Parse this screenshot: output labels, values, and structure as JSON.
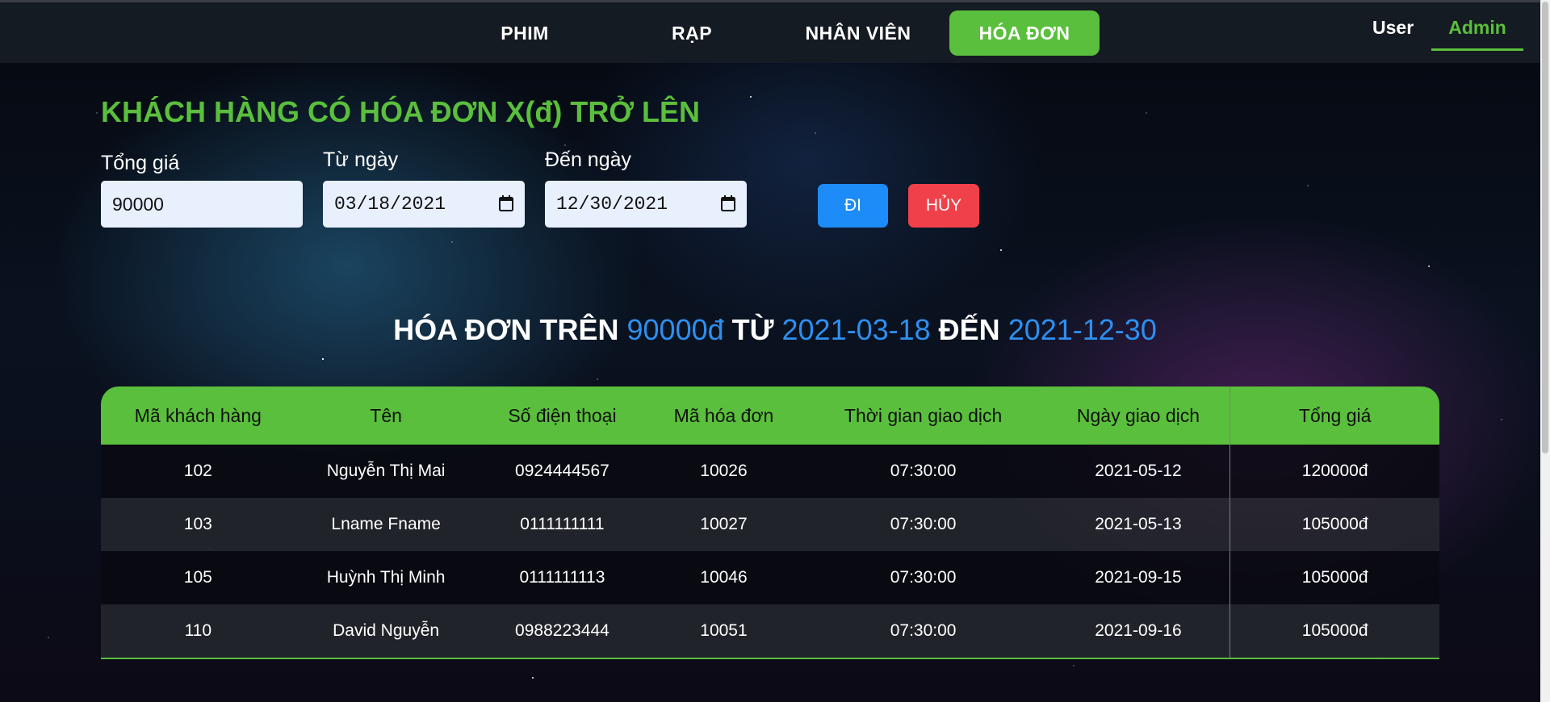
{
  "nav": {
    "items": [
      {
        "label": "PHIM"
      },
      {
        "label": "RẠP"
      },
      {
        "label": "NHÂN VIÊN"
      },
      {
        "label": "HÓA ĐƠN"
      }
    ],
    "active": "HÓA ĐƠN",
    "role_user": "User",
    "role_admin": "Admin",
    "active_color": "#5abf3c"
  },
  "filter": {
    "title": "KHÁCH HÀNG CÓ HÓA ĐƠN X(đ) TRỞ LÊN",
    "total_label": "Tổng giá",
    "total_value": "90000",
    "from_label": "Từ ngày",
    "from_value": "03/18/2021",
    "to_label": "Đến ngày",
    "to_value": "12/30/2021",
    "go_label": "ĐI",
    "cancel_label": "HỦY",
    "go_color": "#1d8cf8",
    "cancel_color": "#f0404a"
  },
  "result": {
    "prefix": "HÓA ĐƠN TRÊN ",
    "amount": "90000đ",
    "from_word": " TỪ ",
    "from_date": "2021-03-18",
    "to_word": " ĐẾN ",
    "to_date": "2021-12-30",
    "highlight_color": "#2e8ff0"
  },
  "table": {
    "headers": [
      "Mã khách hàng",
      "Tên",
      "Số điện thoại",
      "Mã hóa đơn",
      "Thời gian giao dịch",
      "Ngày giao dịch",
      "Tổng giá"
    ],
    "rows": [
      [
        "102",
        "Nguyễn Thị Mai",
        "0924444567",
        "10026",
        "07:30:00",
        "2021-05-12",
        "120000đ"
      ],
      [
        "103",
        "Lname Fname",
        "0111111111",
        "10027",
        "07:30:00",
        "2021-05-13",
        "105000đ"
      ],
      [
        "105",
        "Huỳnh Thị Minh",
        "0111111113",
        "10046",
        "07:30:00",
        "2021-09-15",
        "105000đ"
      ],
      [
        "110",
        "David Nguyễn",
        "0988223444",
        "10051",
        "07:30:00",
        "2021-09-16",
        "105000đ"
      ]
    ]
  }
}
